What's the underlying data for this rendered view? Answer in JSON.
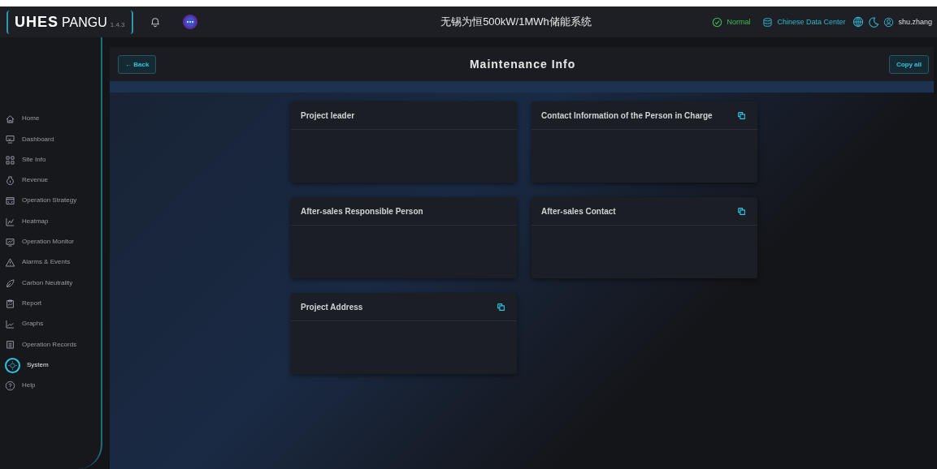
{
  "header": {
    "logo": "UHES",
    "product": "PANGU",
    "version": "1.4.3",
    "site_title": "无锡为恒500kW/1MWh储能系统",
    "status": "Normal",
    "data_center": "Chinese Data Center",
    "user": "shu.zhang"
  },
  "sidebar": {
    "items": [
      {
        "label": "Home",
        "selected": false
      },
      {
        "label": "Dashboard",
        "selected": false
      },
      {
        "label": "Site Info",
        "selected": false
      },
      {
        "label": "Revenue",
        "selected": false
      },
      {
        "label": "Operation Strategy",
        "selected": false
      },
      {
        "label": "Heatmap",
        "selected": false
      },
      {
        "label": "Operation Monitor",
        "selected": false
      },
      {
        "label": "Alarms & Events",
        "selected": false
      },
      {
        "label": "Carbon Neutrality",
        "selected": false
      },
      {
        "label": "Report",
        "selected": false
      },
      {
        "label": "Graphs",
        "selected": false
      },
      {
        "label": "Operation Records",
        "selected": false
      },
      {
        "label": "System",
        "selected": true
      },
      {
        "label": "Help",
        "selected": false
      }
    ]
  },
  "page": {
    "back": "← Back",
    "title": "Maintenance Info",
    "copy_all": "Copy all"
  },
  "cards": [
    {
      "title": "Project leader",
      "copyable": false
    },
    {
      "title": "Contact Information of the Person in Charge",
      "copyable": true
    },
    {
      "title": "After-sales Responsible Person",
      "copyable": false
    },
    {
      "title": "After-sales Contact",
      "copyable": true
    },
    {
      "title": "Project Address",
      "copyable": true
    }
  ]
}
